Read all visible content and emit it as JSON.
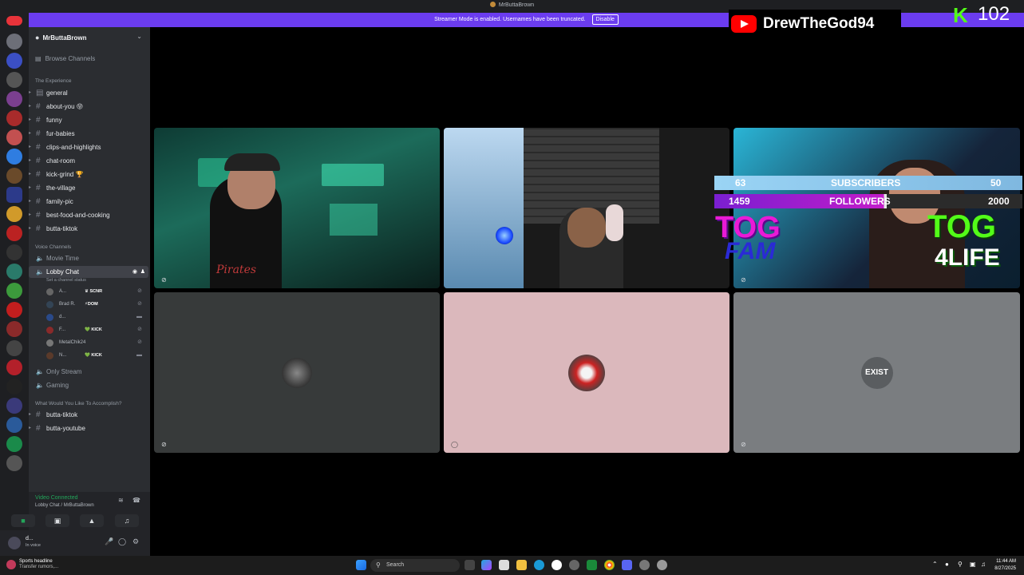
{
  "window": {
    "title": "MrButtaBrown",
    "banner_text": "Streamer Mode is enabled. Usernames have been truncated.",
    "banner_button": "Disable"
  },
  "sidebar": {
    "server_name": "MrButtaBrown",
    "browse": "Browse Channels",
    "category_1": "The Experience",
    "text_channels": [
      "general",
      "about-you 😝",
      "funny",
      "fur-babies",
      "clips-and-highlights",
      "chat-room",
      "kick-grind 🏆",
      "the-village",
      "family-pic",
      "best-food-and-cooking",
      "butta-tiktok"
    ],
    "category_2": "Voice Channels",
    "voice_channels": {
      "movie": "Movie Time",
      "lobby": "Lobby Chat",
      "lobby_status": "Set a channel status",
      "only_stream": "Only Stream",
      "gaming": "Gaming"
    },
    "members": [
      {
        "name": "A...",
        "tag": "♛ SCNR"
      },
      {
        "name": "Brad R.",
        "tag": "⚡DOM"
      },
      {
        "name": "d...",
        "tag": ""
      },
      {
        "name": "F...",
        "tag": "💚 KICK"
      },
      {
        "name": "MetalChik24",
        "tag": ""
      },
      {
        "name": "N...",
        "tag": "💚 KICK"
      }
    ],
    "category_3": "What Would You Like To Accomplish?",
    "bottom_channels": [
      "butta-tiktok",
      "butta-youtube"
    ]
  },
  "voice_panel": {
    "status": "Video Connected",
    "location": "Lobby Chat / MrButtaBrown"
  },
  "user_panel": {
    "name": "d...",
    "status": "In voice"
  },
  "overlays": {
    "youtube_name": "DrewTheGod94",
    "kick_count": "102",
    "subs_left": "63",
    "subs_label": "SUBSCRIBERS",
    "subs_right": "50",
    "followers_left": "1459",
    "followers_label": "FOLLOWERS",
    "followers_right": "2000",
    "tog_fam_1": "TOG",
    "tog_fam_2": "FAM",
    "tog_life_1": "TOG",
    "tog_life_2": "4LIFE",
    "avatar_text": "EXIST",
    "shirt_text": "Pirates"
  },
  "taskbar": {
    "news_title": "Sports headline",
    "news_sub": "Transfer rumors,...",
    "search": "Search",
    "time": "11:44 AM",
    "date": "8/27/2025"
  },
  "colors": {
    "blurple": "#6b3cf0",
    "kick_green": "#53fc18",
    "youtube_red": "#ff0000",
    "tog_magenta": "#e91ad6"
  }
}
